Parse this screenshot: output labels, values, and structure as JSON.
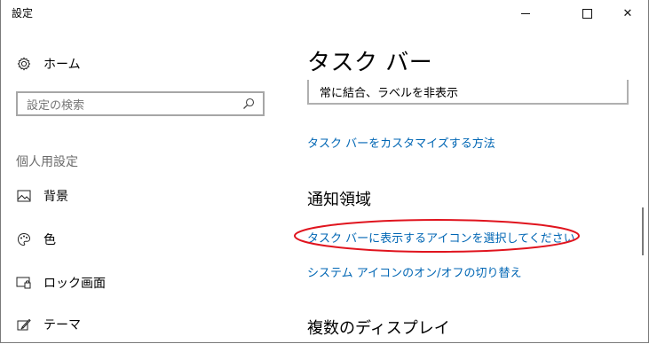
{
  "window": {
    "title": "設定",
    "minimize_glyph": "",
    "close_glyph": "✕"
  },
  "sidebar": {
    "home_label": "ホーム",
    "search_placeholder": "設定の検索",
    "section_label": "個人用設定",
    "items": [
      {
        "label": "背景",
        "icon": "image-icon"
      },
      {
        "label": "色",
        "icon": "palette-icon"
      },
      {
        "label": "ロック画面",
        "icon": "lock-screen-icon"
      },
      {
        "label": "テーマ",
        "icon": "theme-brush-icon"
      }
    ]
  },
  "main": {
    "title": "タスク バー",
    "dropdown_value": "常に結合、ラベルを非表示",
    "link_customize": "タスク バーをカスタマイズする方法",
    "section_notification": "通知領域",
    "link_select_icons": "タスク バーに表示するアイコンを選択してください",
    "link_system_icons": "システム アイコンのオン/オフの切り替え",
    "section_multi_display": "複数のディスプレイ"
  },
  "colors": {
    "link": "#0066b4",
    "annotation_ellipse": "#e0141e"
  }
}
